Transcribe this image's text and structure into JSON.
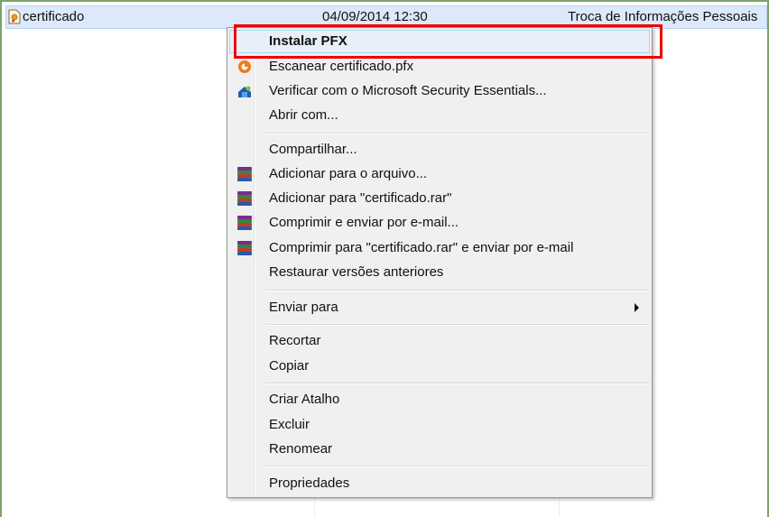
{
  "file_row": {
    "name": "certificado",
    "date": "04/09/2014 12:30",
    "type": "Troca de Informações Pessoais"
  },
  "context_menu": {
    "items": [
      {
        "label": "Instalar PFX",
        "icon": "none"
      },
      {
        "label": "Escanear certificado.pfx",
        "icon": "antivirus-scan-icon"
      },
      {
        "label": "Verificar com o Microsoft Security Essentials...",
        "icon": "security-essentials-icon"
      },
      {
        "label": "Abrir com...",
        "icon": "none"
      },
      {
        "label": "Compartilhar...",
        "icon": "none"
      },
      {
        "label": "Adicionar para o arquivo...",
        "icon": "winrar-icon"
      },
      {
        "label": "Adicionar para \"certificado.rar\"",
        "icon": "winrar-icon"
      },
      {
        "label": "Comprimir e enviar por e-mail...",
        "icon": "winrar-icon"
      },
      {
        "label": "Comprimir para \"certificado.rar\" e enviar por e-mail",
        "icon": "winrar-icon"
      },
      {
        "label": "Restaurar versões anteriores",
        "icon": "none"
      },
      {
        "label": "Enviar para",
        "icon": "none"
      },
      {
        "label": "Recortar",
        "icon": "none"
      },
      {
        "label": "Copiar",
        "icon": "none"
      },
      {
        "label": "Criar Atalho",
        "icon": "none"
      },
      {
        "label": "Excluir",
        "icon": "none"
      },
      {
        "label": "Renomear",
        "icon": "none"
      },
      {
        "label": "Propriedades",
        "icon": "none"
      }
    ]
  },
  "colors": {
    "highlight_border": "#ee0000",
    "row_selected": "#dbe9fb",
    "menu_background": "#f0f0f0"
  }
}
